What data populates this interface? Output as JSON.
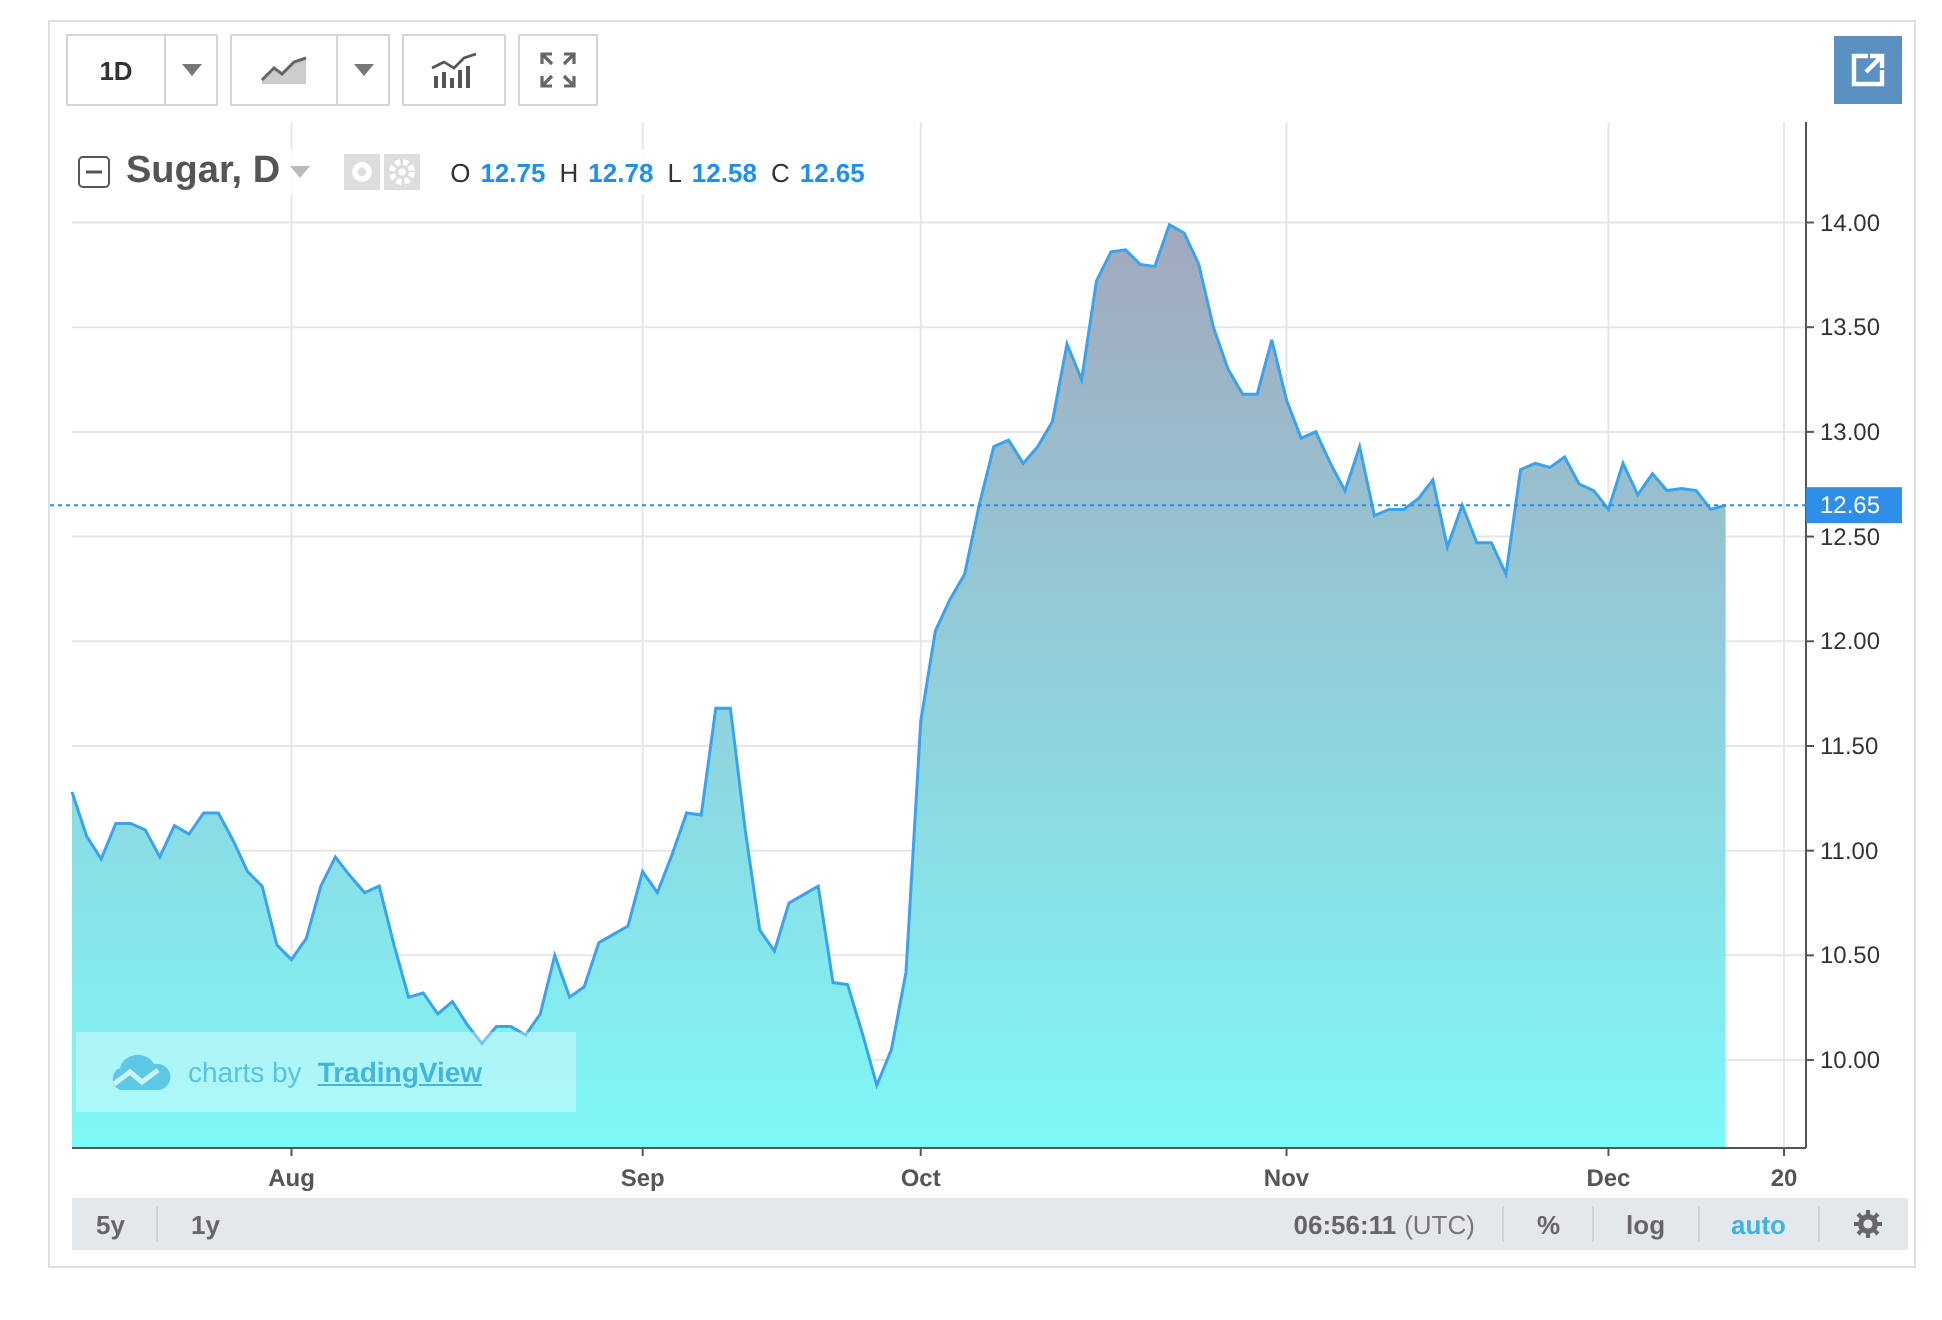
{
  "toolbar": {
    "interval": "1D"
  },
  "legend": {
    "ohlc": [
      {
        "label": "O",
        "value": "12.75"
      },
      {
        "label": "H",
        "value": "12.78"
      },
      {
        "label": "L",
        "value": "12.58"
      },
      {
        "label": "C",
        "value": "12.65"
      }
    ]
  },
  "watermark": {
    "prefix": "charts by",
    "link": "TradingView"
  },
  "chart_data": {
    "type": "area",
    "grid": true,
    "ylim": [
      9.58,
      14.48
    ],
    "categories": [
      null,
      null,
      null,
      null,
      null,
      null,
      null,
      null,
      null,
      null,
      null,
      null,
      null,
      null,
      null,
      "Aug",
      null,
      null,
      null,
      null,
      null,
      null,
      null,
      null,
      null,
      null,
      null,
      null,
      null,
      null,
      null,
      null,
      null,
      null,
      null,
      null,
      null,
      null,
      null,
      "Sep",
      null,
      null,
      null,
      null,
      null,
      null,
      null,
      null,
      null,
      null,
      null,
      null,
      null,
      null,
      null,
      null,
      null,
      null,
      "Oct",
      null,
      null,
      null,
      null,
      null,
      null,
      null,
      null,
      null,
      null,
      null,
      null,
      null,
      null,
      null,
      null,
      null,
      null,
      null,
      null,
      null,
      null,
      null,
      null,
      "Nov",
      null,
      null,
      null,
      null,
      null,
      null,
      null,
      null,
      null,
      null,
      null,
      null,
      null,
      null,
      null,
      null,
      null,
      null,
      null,
      null,
      null,
      "Dec",
      null,
      null,
      null,
      null,
      null,
      null,
      null,
      null,
      null,
      null,
      null,
      "20",
      null
    ],
    "yticks": [
      {
        "value": 10,
        "label": "10.00"
      },
      {
        "value": 10.5,
        "label": "10.50"
      },
      {
        "value": 11,
        "label": "11.00"
      },
      {
        "value": 11.5,
        "label": "11.50"
      },
      {
        "value": 12,
        "label": "12.00"
      },
      {
        "value": 12.5,
        "label": "12.50"
      },
      {
        "value": 13,
        "label": "13.00"
      },
      {
        "value": 13.5,
        "label": "13.50"
      },
      {
        "value": 14,
        "label": "14.00"
      }
    ],
    "series": [
      {
        "name": "Sugar, D",
        "color": "#3ba3ec",
        "values": [
          11.28,
          11.07,
          10.96,
          11.13,
          11.13,
          11.1,
          10.97,
          11.12,
          11.08,
          11.18,
          11.18,
          11.05,
          10.9,
          10.83,
          10.55,
          10.48,
          10.58,
          10.83,
          10.97,
          10.88,
          10.8,
          10.83,
          10.55,
          10.3,
          10.32,
          10.22,
          10.28,
          10.17,
          10.08,
          10.16,
          10.16,
          10.12,
          10.22,
          10.5,
          10.3,
          10.35,
          10.56,
          10.6,
          10.64,
          10.9,
          10.8,
          10.98,
          11.18,
          11.17,
          11.68,
          11.68,
          11.1,
          10.62,
          10.52,
          10.75,
          10.79,
          10.83,
          10.37,
          10.36,
          10.13,
          9.88,
          10.05,
          10.42,
          11.62,
          12.05,
          12.2,
          12.32,
          12.65,
          12.93,
          12.96,
          12.85,
          12.93,
          13.05,
          13.42,
          13.25,
          13.72,
          13.86,
          13.87,
          13.8,
          13.79,
          13.99,
          13.95,
          13.8,
          13.5,
          13.3,
          13.18,
          13.18,
          13.44,
          13.15,
          12.97,
          13,
          12.85,
          12.72,
          12.93,
          12.6,
          12.63,
          12.63,
          12.68,
          12.77,
          12.45,
          12.65,
          12.47,
          12.47,
          12.32,
          12.82,
          12.85,
          12.83,
          12.88,
          12.75,
          12.72,
          12.63,
          12.85,
          12.7,
          12.8,
          12.72,
          12.73,
          12.72,
          12.63,
          12.65,
          null,
          null,
          null,
          null,
          null
        ]
      }
    ],
    "ref_lines": [
      {
        "axis": "y",
        "value": 12.65,
        "label": "12.65",
        "color": "#2f8ee8"
      }
    ]
  },
  "range_buttons": [
    {
      "label": "5y"
    },
    {
      "label": "1y"
    }
  ],
  "clock": {
    "time": "06:56:11",
    "zone": "(UTC)"
  },
  "scale_buttons": [
    {
      "label": "%",
      "selected": false
    },
    {
      "label": "log",
      "selected": false
    },
    {
      "label": "auto",
      "selected": true
    }
  ]
}
